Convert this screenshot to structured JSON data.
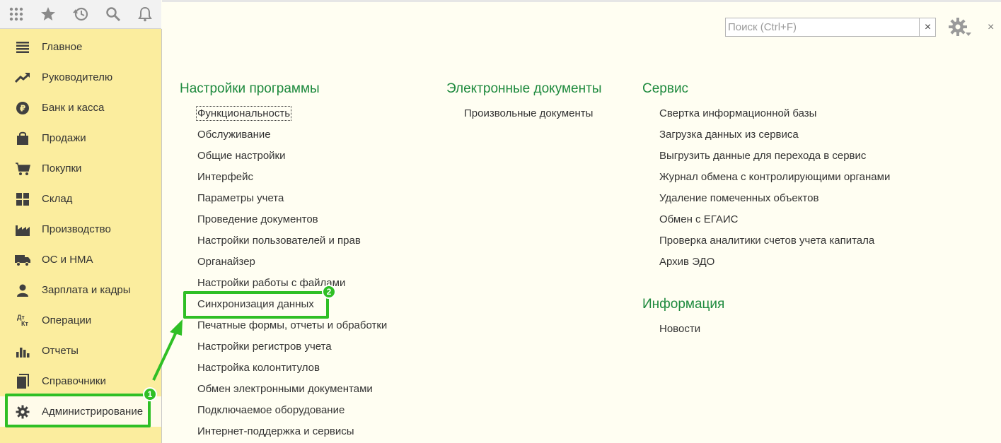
{
  "toolbar": {
    "icons": [
      "apps-grid-icon",
      "favorites-star-icon",
      "history-icon",
      "search-icon",
      "notifications-bell-icon"
    ]
  },
  "sidebar": {
    "items": [
      {
        "label": "Главное",
        "icon": "menu-lines-icon"
      },
      {
        "label": "Руководителю",
        "icon": "trend-up-icon"
      },
      {
        "label": "Банк и касса",
        "icon": "ruble-coin-icon"
      },
      {
        "label": "Продажи",
        "icon": "shopping-bag-icon"
      },
      {
        "label": "Покупки",
        "icon": "shopping-cart-icon"
      },
      {
        "label": "Склад",
        "icon": "warehouse-grid-icon"
      },
      {
        "label": "Производство",
        "icon": "factory-icon"
      },
      {
        "label": "ОС и НМА",
        "icon": "truck-icon"
      },
      {
        "label": "Зарплата и кадры",
        "icon": "person-icon"
      },
      {
        "label": "Операции",
        "icon": "debit-credit-icon",
        "glyph_top": "Дт",
        "glyph_bottom": "Кт"
      },
      {
        "label": "Отчеты",
        "icon": "bar-chart-icon"
      },
      {
        "label": "Справочники",
        "icon": "book-icon"
      },
      {
        "label": "Администрирование",
        "icon": "gear-icon",
        "active": true
      }
    ]
  },
  "header": {
    "search_placeholder": "Поиск (Ctrl+F)",
    "clear_label": "×",
    "close_label": "×"
  },
  "sections": {
    "settings": {
      "title": "Настройки программы",
      "items": [
        "Функциональность",
        "Обслуживание",
        "Общие настройки",
        "Интерфейс",
        "Параметры учета",
        "Проведение документов",
        "Настройки пользователей и прав",
        "Органайзер",
        "Настройки работы с файлами",
        "Синхронизация данных",
        "Печатные формы, отчеты и обработки",
        "Настройки регистров учета",
        "Настройка колонтитулов",
        "Обмен электронными документами",
        "Подключаемое оборудование",
        "Интернет-поддержка и сервисы"
      ]
    },
    "edocs": {
      "title": "Электронные документы",
      "items": [
        "Произвольные документы"
      ]
    },
    "service": {
      "title": "Сервис",
      "items": [
        "Свертка информационной базы",
        "Загрузка данных из сервиса",
        "Выгрузить данные для перехода в сервис",
        "Журнал обмена с контролирующими органами",
        "Удаление помеченных объектов",
        "Обмен с ЕГАИС",
        "Проверка аналитики счетов учета капитала",
        "Архив ЭДО"
      ]
    },
    "info": {
      "title": "Информация",
      "items": [
        "Новости"
      ]
    }
  },
  "annotations": {
    "badge_1": "1",
    "badge_2": "2",
    "color": "#2fbf25"
  },
  "colors": {
    "sidebar_bg": "#fbed9e",
    "heading_green": "#1e8a3e"
  }
}
